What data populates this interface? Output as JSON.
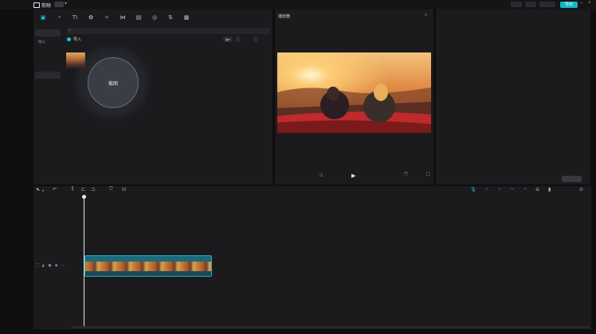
{
  "titlebar": {
    "app_name": "剪映",
    "project_title": "",
    "export_label": "导出"
  },
  "toolbar": {
    "tools": [
      {
        "icon": "media-icon",
        "label": "",
        "glyph": "▣"
      },
      {
        "icon": "audio-icon",
        "label": "",
        "glyph": "◔"
      },
      {
        "icon": "text-icon",
        "label": "",
        "glyph": "TI"
      },
      {
        "icon": "sticker-icon",
        "label": "",
        "glyph": "✿"
      },
      {
        "icon": "effects-icon",
        "label": "",
        "glyph": "✧"
      },
      {
        "icon": "transition-icon",
        "label": "",
        "glyph": "⋈"
      },
      {
        "icon": "caption-icon",
        "label": "",
        "glyph": "▤"
      },
      {
        "icon": "filter-icon",
        "label": "",
        "glyph": "◎"
      },
      {
        "icon": "adjust-icon",
        "label": "",
        "glyph": "⇅"
      },
      {
        "icon": "template-icon",
        "label": "",
        "glyph": "▦"
      }
    ]
  },
  "sidebar": {
    "items": [
      {
        "label": ""
      },
      {
        "label": "导入"
      },
      {
        "label": ""
      },
      {
        "label": ""
      },
      {
        "label": ""
      }
    ]
  },
  "media": {
    "search_placeholder": "",
    "import_label": "导入",
    "filter_sort": "",
    "filter_all": "",
    "filter_type": "",
    "clip_group_label": "",
    "clip_duration": "",
    "screenshot_label": "截图"
  },
  "player": {
    "title": "播放器",
    "current_time": "",
    "total_time": "",
    "ratio_label": ""
  },
  "properties": {
    "title": "",
    "rows": [
      {
        "key": "",
        "value": ""
      },
      {
        "key": "",
        "value": ""
      },
      {
        "key": "",
        "value": ""
      },
      {
        "key": "",
        "value": ""
      },
      {
        "key": "",
        "value": ""
      },
      {
        "key": "",
        "value": ""
      },
      {
        "key": "",
        "value": ""
      },
      {
        "key": "",
        "value": ""
      },
      {
        "key": "",
        "value": ""
      }
    ],
    "footer_text": "",
    "modify_label": ""
  },
  "timeline": {
    "ruler_ticks": [
      "",
      "",
      "",
      "",
      "",
      "",
      ""
    ],
    "track_label": "",
    "clip_name": ""
  },
  "colors": {
    "accent": "#12c8dc",
    "panel": "#1b1b1e",
    "background": "#0e0e10"
  }
}
